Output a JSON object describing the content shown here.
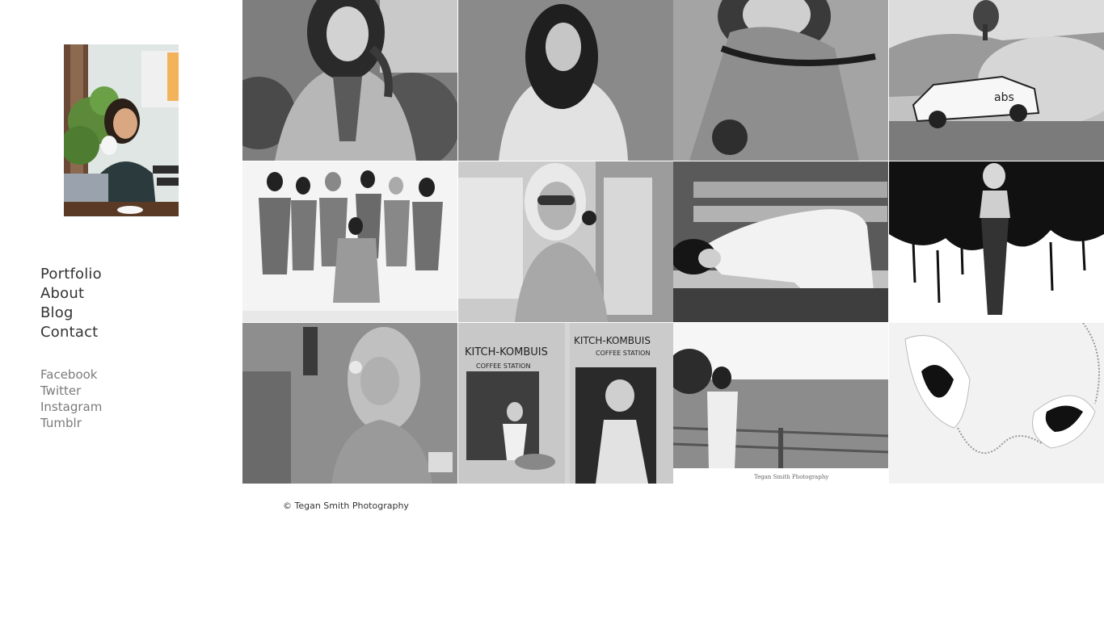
{
  "nav": {
    "main": [
      {
        "label": "Portfolio"
      },
      {
        "label": "About"
      },
      {
        "label": "Blog"
      },
      {
        "label": "Contact"
      }
    ],
    "social": [
      {
        "label": "Facebook"
      },
      {
        "label": "Twitter"
      },
      {
        "label": "Instagram"
      },
      {
        "label": "Tumblr"
      }
    ]
  },
  "gallery": {
    "tiles": [
      {
        "name": "photo-woman-sweater-necklace"
      },
      {
        "name": "photo-woman-fur-coat"
      },
      {
        "name": "photo-woman-veil"
      },
      {
        "name": "photo-rally-car"
      },
      {
        "name": "photo-group-women"
      },
      {
        "name": "photo-woman-sunglasses-phone"
      },
      {
        "name": "photo-woman-bench"
      },
      {
        "name": "photo-woman-lace-graffiti"
      },
      {
        "name": "photo-woman-telephone"
      },
      {
        "name": "photo-kitch-kombuis-coffee-station"
      },
      {
        "name": "photo-woman-vineyard"
      },
      {
        "name": "photo-feather-earrings"
      }
    ],
    "signature": "Tegan Smith Photography",
    "storefront_sign": "KITCH-KOMBUIS",
    "storefront_subsign": "COFFEE STATION",
    "car_logo": "abs"
  },
  "footer": {
    "copyright": "© Tegan Smith Photography"
  }
}
